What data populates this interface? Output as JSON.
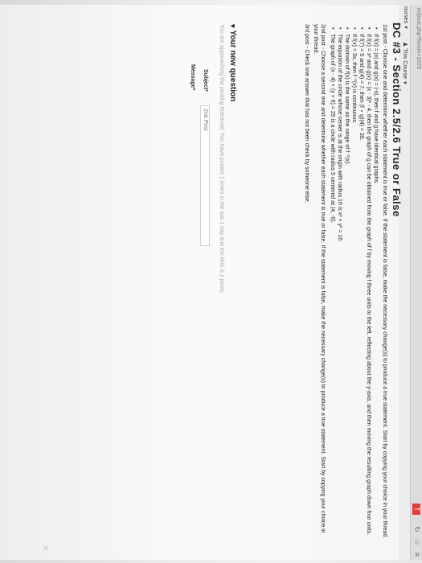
{
  "browser": {
    "url": "m/post.php?forum=1629",
    "icons": [
      "↻",
      "☆",
      "≡"
    ],
    "extension_badge": "T"
  },
  "nav": {
    "courses": "ourses",
    "course_menu": "This Course"
  },
  "section": {
    "title": "DC #3 - Section 2.5/2.6 True or False"
  },
  "post1": {
    "intro": "1st post - Choose one and determine whether each statement is true or false. If the statement is false, make the necessary change(s) to produce a true statement. Start by copying your choice in your thread.",
    "items": [
      "If f(x) = |x| and g(x) = |-x|, then f and g have identical graphs.",
      "If f(x) = x² and g(x) = (x - 3)² - 4, then the graph of g can be obtained from the graph of f by moving f three units to the left, reflecting about the y-axis, and then moving the resulting graph down four units.",
      "If f(7) = 5 and g(4) = 7, then (f ∘ g)(4) = 35.",
      "If f(x) = 3x, then f⁻¹(x) is continuous.",
      "The domain of f(x) is the same as the range of f⁻¹(x).",
      "The equation of the circle whose center is at the origin with radius 16 is x² + y² = 16.",
      "The graph of (x - 4) + (y + 6) = 25 is a circle with radius 5 centered at (4, -6)."
    ]
  },
  "post2": {
    "text": "2nd post - Choose a second one and determine whether each statement is true or false. If the statement is false, make the necessary change(s) to produce a true statement. Start by copying your choice in your thread."
  },
  "post3": {
    "text": "3rd post - Check one answer that has not been check by someone else."
  },
  "new_question": {
    "heading": "Your new question",
    "notice": "You are approaching the posting threshold. You have posted 1 times in the last 1 day and the limit is 2 posts."
  },
  "form": {
    "subject_label": "Subject*",
    "subject_value": "2nd Post",
    "message_label": "Message*"
  }
}
